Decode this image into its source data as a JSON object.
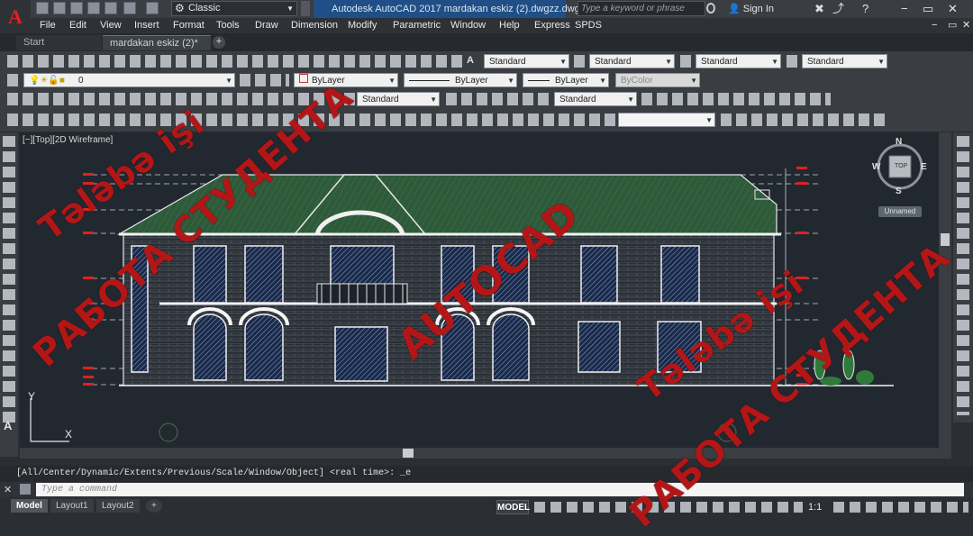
{
  "app": {
    "logo_letter": "A",
    "workspace": "Classic",
    "window_title": "Autodesk AutoCAD 2017    mardakan eskiz (2).dwgzz.dwg",
    "search_placeholder": "Type a keyword or phrase",
    "signin_label": "Sign In",
    "help_label": "?"
  },
  "menu": [
    "File",
    "Edit",
    "View",
    "Insert",
    "Format",
    "Tools",
    "Draw",
    "Dimension",
    "Modify",
    "Parametric",
    "Window",
    "Help",
    "Express",
    "SPDS"
  ],
  "tabs": {
    "start": "Start",
    "drawing": "mardakan eskiz (2)*",
    "add": "+"
  },
  "toolbars": {
    "text_style": "Standard",
    "dim_style": "Standard",
    "table_style": "Standard",
    "multileader_style": "Standard",
    "layer": "0",
    "color": "ByLayer",
    "linetype": "ByLayer",
    "lineweight": "ByLayer",
    "plot_style": "ByColor",
    "annot_style": "Standard",
    "mleader_style2": "Standard"
  },
  "viewport": {
    "label": "[−][Top][2D Wireframe]",
    "compass": {
      "n": "N",
      "s": "S",
      "e": "E",
      "w": "W",
      "top": "TOP"
    },
    "wcs": "Unnamed",
    "ucs_x": "X",
    "ucs_y": "Y"
  },
  "command": {
    "history": "[All/Center/Dynamic/Extents/Previous/Scale/Window/Object] <real time>: _e",
    "placeholder": "Type a command"
  },
  "status": {
    "layouts": [
      "Model",
      "Layout1",
      "Layout2"
    ],
    "add_layout": "+",
    "space": "MODEL",
    "scale": "1:1"
  },
  "watermarks": {
    "line1": "Tələbə işi",
    "line2": "РАБОТА СТУДЕНТА",
    "line3": "AUTOCAD",
    "line4": "Tələbə işi",
    "line5": "РАБОТА СТУДЕНТА"
  },
  "colors": {
    "canvas": "#212830",
    "drawing_lines": "#e8e8e8",
    "window_fill": "#1a2a4a",
    "roof_fill": "#2e5a3a",
    "watermark": "#e61c1c",
    "title_highlight": "#1f4f86"
  }
}
